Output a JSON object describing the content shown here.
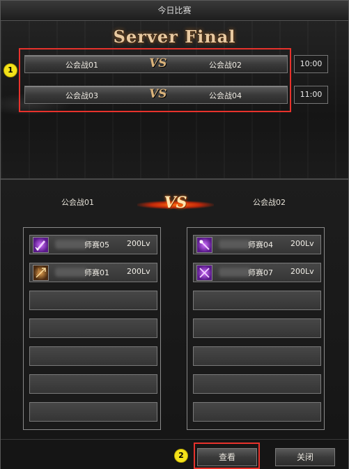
{
  "window": {
    "title": "今日比赛"
  },
  "banner": {
    "text": "Server Final"
  },
  "matches": [
    {
      "team1": "公会战01",
      "vs": "VS",
      "team2": "公会战02",
      "time": "10:00"
    },
    {
      "team1": "公会战03",
      "vs": "VS",
      "team2": "公会战04",
      "time": "11:00"
    }
  ],
  "markers": {
    "one": "1",
    "two": "2"
  },
  "detail": {
    "team_left": "公会战01",
    "vs": "VS",
    "team_right": "公会战02"
  },
  "left_roster": [
    {
      "name": "师赛05",
      "level": "200Lv",
      "icon": "sword-class-icon"
    },
    {
      "name": "师赛01",
      "level": "200Lv",
      "icon": "bow-class-icon"
    }
  ],
  "right_roster": [
    {
      "name": "师赛04",
      "level": "200Lv",
      "icon": "wand-class-icon"
    },
    {
      "name": "师赛07",
      "level": "200Lv",
      "icon": "dual-blade-class-icon"
    }
  ],
  "buttons": {
    "view": "查看",
    "close": "关闭"
  },
  "colors": {
    "highlight": "#e8322c",
    "marker": "#f4e21a",
    "vs_fire": "#ff6a10"
  }
}
